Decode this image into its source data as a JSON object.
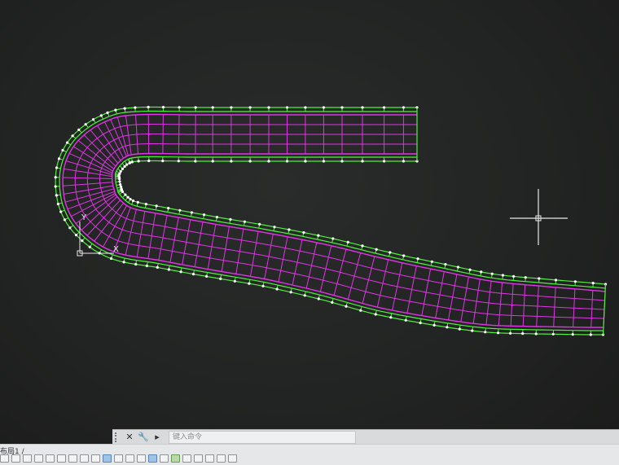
{
  "app": {
    "command_prompt": "键入命令",
    "layout_tab_label": "布局1 /",
    "status_tools": [
      "snap-icon",
      "grid-icon",
      "ortho-icon",
      "polar-icon",
      "osnap-icon",
      "otrack-icon",
      "ducs-icon",
      "dyn-icon",
      "lineweight-icon",
      "transparency-icon",
      "qp-icon",
      "sc-icon",
      "am-icon",
      "model-icon",
      "annotation-icon",
      "workspace-icon",
      "lock-icon",
      "isolate-icon",
      "hardware-icon",
      "clean-icon",
      "customize-icon"
    ]
  },
  "drawing": {
    "ucs_x_label": "X",
    "ucs_y_label": "Y",
    "colors": {
      "edge": "#4ff03a",
      "grid": "#e033e6",
      "crosshair": "#e8e8e8",
      "background": "#222423"
    }
  }
}
